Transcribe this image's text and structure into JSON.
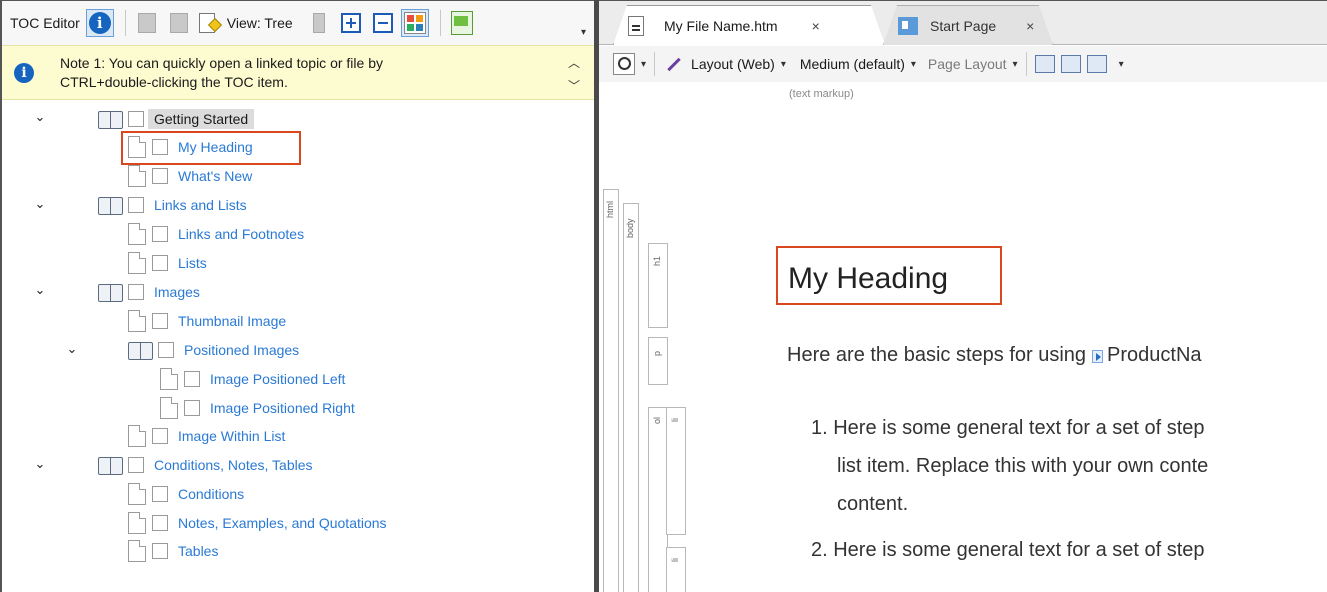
{
  "left_pane": {
    "toolbar": {
      "title": "TOC Editor",
      "view_label": "View: Tree"
    },
    "note": {
      "text_line1": "Note 1: You can quickly open a linked topic or file by",
      "text_line2": "CTRL+double-clicking the TOC item."
    },
    "tree": {
      "n1": "Getting Started",
      "n2": "My Heading",
      "n3": "What's New",
      "n4": "Links and Lists",
      "n5": "Links and Footnotes",
      "n6": "Lists",
      "n7": "Images",
      "n8": "Thumbnail Image",
      "n9": "Positioned Images",
      "n10": "Image Positioned Left",
      "n11": "Image Positioned Right",
      "n12": "Image Within List",
      "n13": "Conditions, Notes, Tables",
      "n14": "Conditions",
      "n15": "Notes, Examples, and Quotations",
      "n16": "Tables"
    }
  },
  "right_pane": {
    "tabs": {
      "active": "My File Name.htm",
      "inactive": "Start Page",
      "close_glyph": "×"
    },
    "toolbar": {
      "layout": "Layout (Web)",
      "medium": "Medium (default)",
      "page_layout": "Page Layout"
    },
    "markup_hint": "(text markup)",
    "gutter_tags": {
      "html": "html",
      "body": "body",
      "h1": "h1",
      "p": "p",
      "ol": "ol",
      "li": "li"
    },
    "document": {
      "heading": "My Heading",
      "intro": "Here are the basic steps for using",
      "variable": "ProductNa",
      "item1_line1": "1.  Here is some general text for a set of step",
      "item1_line2": "list item. Replace this with your own conte",
      "item1_line3": "content.",
      "item2_line1": "2.  Here is some general text for a set of step"
    }
  },
  "colors": {
    "link": "#2a7ad5",
    "highlight": "#d9471f",
    "note_bg": "#fdfbd0",
    "info_blue": "#1565c0"
  },
  "icons": [
    "info-icon",
    "book-icon",
    "doc-icon",
    "checkbox-icon",
    "chevron-down-icon",
    "close-icon",
    "magnifier-icon"
  ]
}
